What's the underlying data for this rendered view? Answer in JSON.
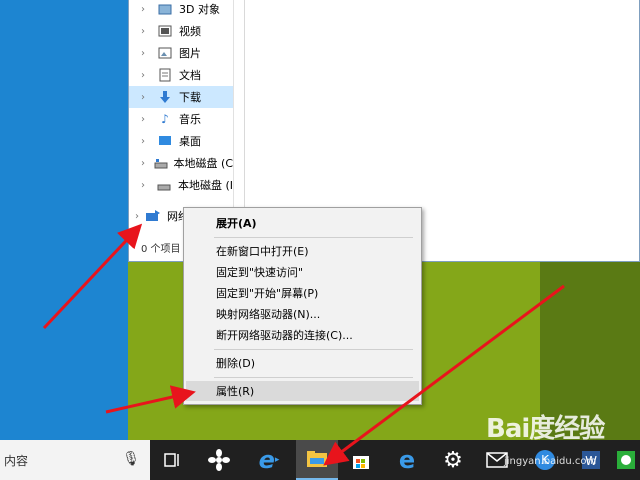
{
  "explorer": {
    "nav_items": [
      {
        "label": "3D 对象",
        "icon": "3d-objects-icon",
        "selected": false
      },
      {
        "label": "视频",
        "icon": "videos-icon",
        "selected": false
      },
      {
        "label": "图片",
        "icon": "pictures-icon",
        "selected": false
      },
      {
        "label": "文档",
        "icon": "documents-icon",
        "selected": false
      },
      {
        "label": "下载",
        "icon": "download-icon",
        "selected": true
      },
      {
        "label": "音乐",
        "icon": "music-icon",
        "selected": false
      },
      {
        "label": "桌面",
        "icon": "desktop-icon",
        "selected": false
      },
      {
        "label": "本地磁盘 (C",
        "icon": "drive-icon",
        "selected": false
      },
      {
        "label": "本地磁盘 (I",
        "icon": "drive-icon",
        "selected": false
      },
      {
        "label": "网络",
        "icon": "network-icon",
        "selected": false
      }
    ],
    "status_text": "0 个项目"
  },
  "context_menu": {
    "items": [
      {
        "label": "展开(A)",
        "bold": true
      },
      {
        "label": "在新窗口中打开(E)"
      },
      {
        "label": "固定到\"快速访问\""
      },
      {
        "label": "固定到\"开始\"屏幕(P)"
      },
      {
        "label": "映射网络驱动器(N)..."
      },
      {
        "label": "断开网络驱动器的连接(C)..."
      },
      {
        "label": "删除(D)"
      },
      {
        "label": "属性(R)",
        "highlighted": true
      }
    ]
  },
  "taskbar": {
    "search_text": "内容",
    "buttons": [
      "task-view-icon",
      "fan-app-icon",
      "edge-icon",
      "file-explorer-icon",
      "store-icon",
      "edge-browser-icon",
      "settings-icon",
      "mail-icon",
      "app-icon",
      "word-icon",
      "wechat-icon"
    ]
  },
  "watermark": {
    "brand": "Bai度经验",
    "url": "jingyan.baidu.com"
  },
  "colors": {
    "selection": "#cce8ff",
    "arrow": "#e8141c",
    "taskbar": "#202020"
  }
}
